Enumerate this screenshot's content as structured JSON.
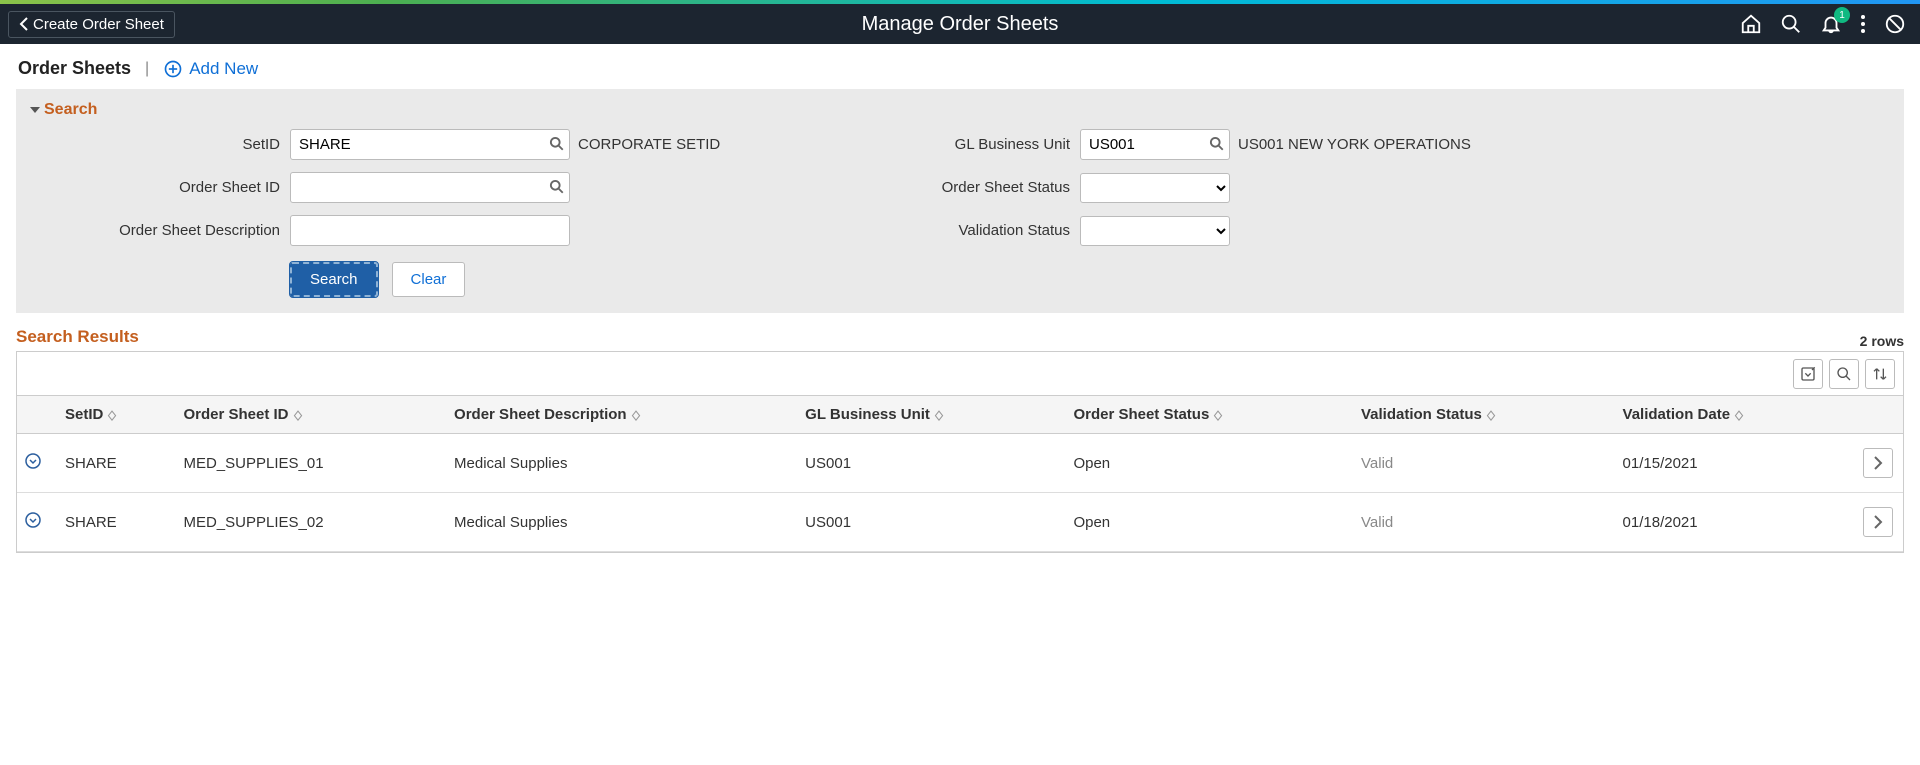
{
  "header": {
    "back_label": "Create Order Sheet",
    "page_title": "Manage Order Sheets",
    "notification_count": "1"
  },
  "subheader": {
    "title": "Order Sheets",
    "separator": "|",
    "add_new_label": "Add New"
  },
  "search_panel": {
    "heading": "Search",
    "setid": {
      "label": "SetID",
      "value": "SHARE",
      "desc": "CORPORATE SETID"
    },
    "gl_bu": {
      "label": "GL Business Unit",
      "value": "US001",
      "desc": "US001 NEW YORK OPERATIONS"
    },
    "order_sheet_id": {
      "label": "Order Sheet ID",
      "value": ""
    },
    "order_sheet_status": {
      "label": "Order Sheet Status",
      "value": ""
    },
    "order_sheet_desc": {
      "label": "Order Sheet Description",
      "value": ""
    },
    "validation_status": {
      "label": "Validation Status",
      "value": ""
    },
    "search_button": "Search",
    "clear_button": "Clear"
  },
  "results": {
    "heading": "Search Results",
    "row_count_label": "2 rows",
    "columns": {
      "setid": "SetID",
      "order_sheet_id": "Order Sheet ID",
      "order_sheet_desc": "Order Sheet Description",
      "gl_bu": "GL Business Unit",
      "status": "Order Sheet Status",
      "validation_status": "Validation Status",
      "validation_date": "Validation Date"
    },
    "rows": [
      {
        "setid": "SHARE",
        "order_sheet_id": "MED_SUPPLIES_01",
        "order_sheet_desc": "Medical Supplies",
        "gl_bu": "US001",
        "status": "Open",
        "validation_status": "Valid",
        "validation_date": "01/15/2021"
      },
      {
        "setid": "SHARE",
        "order_sheet_id": "MED_SUPPLIES_02",
        "order_sheet_desc": "Medical Supplies",
        "gl_bu": "US001",
        "status": "Open",
        "validation_status": "Valid",
        "validation_date": "01/18/2021"
      }
    ]
  }
}
